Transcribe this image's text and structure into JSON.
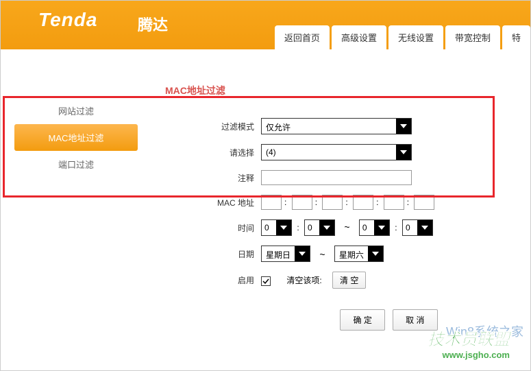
{
  "header": {
    "logo_text": "Tenda",
    "logo_cn": "腾达",
    "nav_tabs": [
      "返回首页",
      "高级设置",
      "无线设置",
      "带宽控制",
      "特"
    ]
  },
  "sidebar": {
    "items": [
      {
        "label": "网站过滤",
        "active": false
      },
      {
        "label": "MAC地址过滤",
        "active": true
      },
      {
        "label": "端口过滤",
        "active": false
      }
    ]
  },
  "main": {
    "title": "MAC地址过滤",
    "form": {
      "filter_mode_label": "过滤模式",
      "filter_mode_value": "仅允许",
      "select_label": "请选择",
      "select_value": "(4)",
      "comment_label": "注释",
      "comment_value": "",
      "mac_label": "MAC 地址",
      "mac_values": [
        "",
        "",
        "",
        "",
        "",
        ""
      ],
      "time_label": "时间",
      "time_start_h": "0",
      "time_start_m": "0",
      "time_end_h": "0",
      "time_end_m": "0",
      "date_label": "日期",
      "date_start": "星期日",
      "date_end": "星期六",
      "enable_label": "启用",
      "enable_checked": true,
      "clear_label": "清空该项:",
      "clear_btn": "清 空",
      "confirm_btn": "确 定",
      "cancel_btn": "取 消"
    }
  },
  "watermark": {
    "title": "技术员联盟",
    "url": "www.jsgho.com",
    "bg_text": "Win8系统之家"
  }
}
